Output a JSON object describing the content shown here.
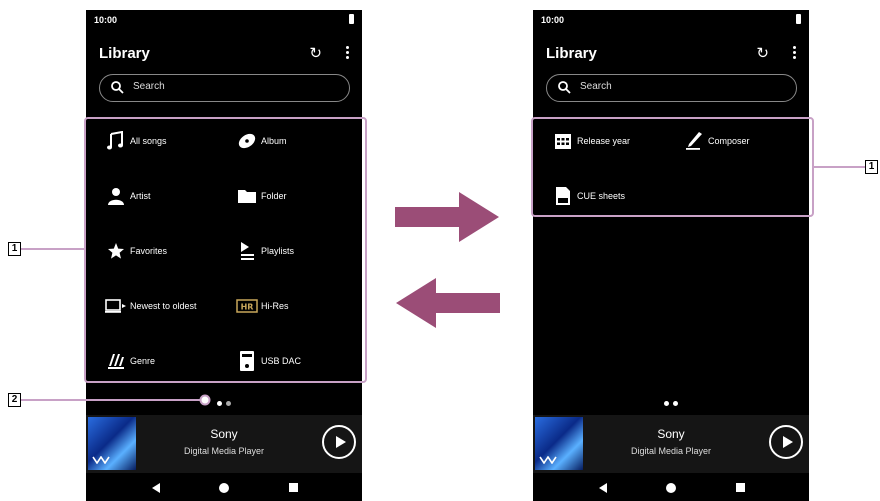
{
  "left_screen": {
    "status_time": "10:00",
    "title": "Library",
    "search_placeholder": "Search",
    "items": [
      {
        "label": "All songs",
        "icon": "music-note-icon"
      },
      {
        "label": "Album",
        "icon": "disc-icon"
      },
      {
        "label": "Artist",
        "icon": "person-icon"
      },
      {
        "label": "Folder",
        "icon": "folder-icon"
      },
      {
        "label": "Favorites",
        "icon": "star-icon"
      },
      {
        "label": "Playlists",
        "icon": "playlist-icon"
      },
      {
        "label": "Newest to oldest",
        "icon": "newest-device-icon"
      },
      {
        "label": "Hi-Res",
        "icon": "hi-res-badge-icon"
      },
      {
        "label": "Genre",
        "icon": "genre-icon"
      },
      {
        "label": "USB DAC",
        "icon": "usb-dac-icon"
      }
    ],
    "player": {
      "title": "Sony",
      "subtitle": "Digital Media Player"
    }
  },
  "right_screen": {
    "status_time": "10:00",
    "title": "Library",
    "search_placeholder": "Search",
    "items": [
      {
        "label": "Release year",
        "icon": "calendar-icon"
      },
      {
        "label": "Composer",
        "icon": "pen-icon"
      },
      {
        "label": "CUE sheets",
        "icon": "cue-sheet-icon"
      }
    ],
    "player": {
      "title": "Sony",
      "subtitle": "Digital Media Player"
    }
  },
  "callouts": {
    "left_1": "1",
    "left_2": "2",
    "right_1": "1"
  },
  "colors": {
    "highlight": "#c8a1c6",
    "arrow": "#9b4d77",
    "screen_bg": "#000000"
  }
}
